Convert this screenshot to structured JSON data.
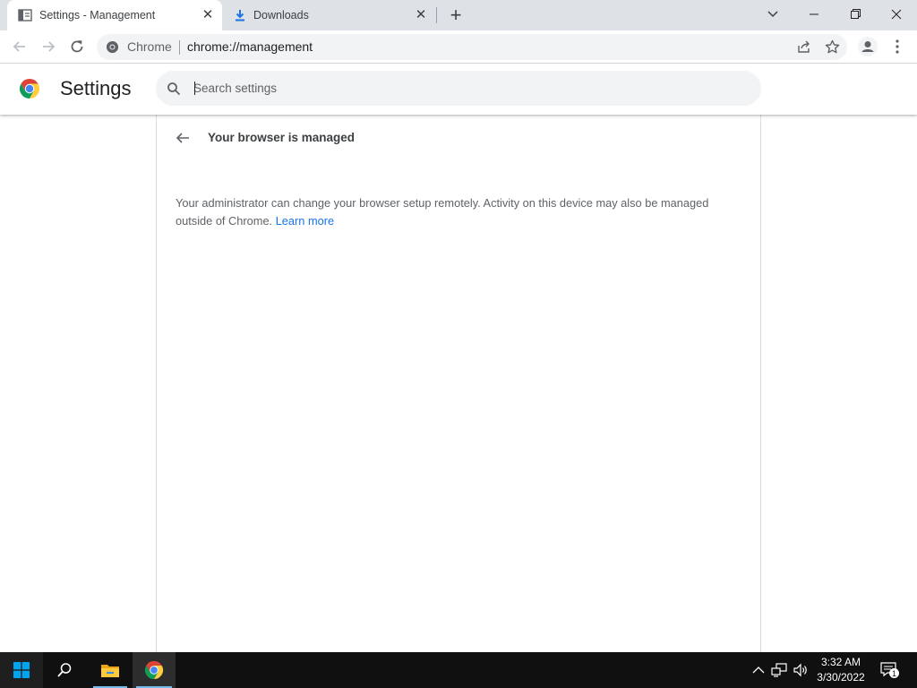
{
  "tabs": [
    {
      "title": "Settings - Management",
      "icon": "settings-page-icon",
      "active": true
    },
    {
      "title": "Downloads",
      "icon": "download-icon",
      "active": false
    }
  ],
  "toolbar": {
    "site_chip": "Chrome",
    "url": "chrome://management"
  },
  "settings": {
    "title": "Settings",
    "search_placeholder": "Search settings"
  },
  "page": {
    "heading": "Your browser is managed",
    "description": "Your administrator can change your browser setup remotely. Activity on this device may also be managed outside of Chrome.",
    "learn_more": "Learn more"
  },
  "taskbar": {
    "time": "3:32 AM",
    "date": "3/30/2022",
    "notification_count": "1"
  },
  "colors": {
    "accent": "#1a73e8",
    "tabstrip": "#dee1e6",
    "taskbar": "#101010"
  }
}
